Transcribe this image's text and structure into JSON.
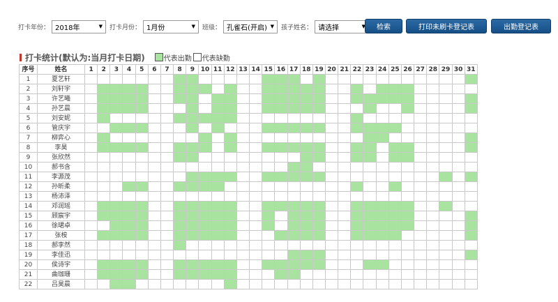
{
  "filters": {
    "year_label": "打卡年份：",
    "year_value": "2018年",
    "month_label": "打卡月份：",
    "month_value": "1月份",
    "class_label": "班级：",
    "class_value": "孔雀石(开启)",
    "child_label": "孩子姓名：",
    "child_value": "请选择"
  },
  "buttons": {
    "search": "检索",
    "print_unpunched": "打印未刷卡登记表",
    "attendance_register": "出勤登记表"
  },
  "stats": {
    "title": "打卡统计(默认为:当月打卡日期)",
    "legend_present": "代表出勤",
    "legend_absent": "代表缺勤"
  },
  "colors": {
    "present": "#a8e4a0",
    "button": "#1e5c96"
  },
  "table": {
    "header_index": "序号",
    "header_name": "姓名",
    "days": [
      1,
      2,
      3,
      4,
      5,
      6,
      7,
      8,
      9,
      10,
      11,
      12,
      13,
      14,
      15,
      16,
      17,
      18,
      19,
      20,
      21,
      22,
      23,
      24,
      25,
      26,
      27,
      28,
      29,
      30,
      31
    ],
    "rows": [
      {
        "index": "1",
        "name": "夏艺轩",
        "present": [
          8,
          9,
          15,
          16,
          17,
          19,
          31
        ]
      },
      {
        "index": "2",
        "name": "刘轩宇",
        "present": [
          2,
          3,
          4,
          5,
          8,
          9,
          10,
          12,
          15,
          16,
          17,
          18,
          19,
          22,
          24,
          25,
          26
        ]
      },
      {
        "index": "3",
        "name": "许艺曦",
        "present": [
          2,
          3,
          4,
          5,
          8,
          9,
          11,
          12,
          15,
          16,
          17,
          18,
          19,
          22,
          23,
          24,
          25,
          26,
          31
        ]
      },
      {
        "index": "4",
        "name": "孙艺晨",
        "present": [
          2,
          3,
          4,
          5,
          9,
          11,
          12,
          15,
          16,
          17,
          18,
          19,
          23,
          26,
          31
        ]
      },
      {
        "index": "5",
        "name": "刘安妮",
        "present": [
          2,
          8,
          9,
          10,
          11,
          12,
          22
        ]
      },
      {
        "index": "6",
        "name": "管庆宇",
        "present": [
          3,
          4,
          5,
          9,
          11,
          15,
          16,
          17,
          18,
          19,
          22,
          23,
          24,
          25
        ]
      },
      {
        "index": "7",
        "name": "柳弈心",
        "present": [
          2,
          10,
          12,
          23,
          24,
          31
        ]
      },
      {
        "index": "8",
        "name": "李昊",
        "present": [
          2,
          3,
          4,
          5,
          8,
          9,
          10,
          12,
          15,
          16,
          17,
          18,
          19,
          22,
          23,
          25,
          26,
          31
        ]
      },
      {
        "index": "9",
        "name": "张欣然",
        "present": [
          8,
          9,
          18,
          19,
          22,
          23,
          25,
          26
        ]
      },
      {
        "index": "10",
        "name": "郝书含",
        "present": [
          17,
          18
        ]
      },
      {
        "index": "11",
        "name": "李源茂",
        "present": [
          9,
          10,
          11,
          12,
          15,
          16,
          17,
          18,
          19,
          29,
          31
        ]
      },
      {
        "index": "12",
        "name": "孙昕柔",
        "present": [
          4,
          5,
          8,
          9,
          10,
          11,
          22,
          25
        ]
      },
      {
        "index": "13",
        "name": "杨沛泽",
        "present": []
      },
      {
        "index": "14",
        "name": "邓润瑶",
        "present": [
          2,
          3,
          4,
          5,
          8,
          9,
          10,
          11,
          12,
          15,
          16,
          17,
          18,
          19,
          22,
          23,
          24,
          25,
          26,
          29
        ]
      },
      {
        "index": "15",
        "name": "顾宸宇",
        "present": [
          2,
          3,
          4,
          5,
          8,
          9,
          10,
          11,
          12,
          15,
          17,
          18,
          19,
          22,
          23,
          24,
          25,
          26,
          31
        ]
      },
      {
        "index": "16",
        "name": "徐珺卓",
        "present": [
          3,
          4,
          5,
          8,
          9,
          10,
          11,
          12,
          15,
          17,
          18,
          19,
          22,
          23,
          24,
          25,
          26,
          31
        ]
      },
      {
        "index": "17",
        "name": "张桉",
        "present": [
          2,
          3,
          4,
          5,
          8,
          9,
          10,
          11,
          12,
          16,
          17,
          18,
          19,
          22,
          23,
          24,
          25,
          31
        ]
      },
      {
        "index": "18",
        "name": "郝李然",
        "present": [
          8
        ]
      },
      {
        "index": "19",
        "name": "李佳迅",
        "present": [
          17,
          18,
          19,
          31
        ]
      },
      {
        "index": "20",
        "name": "侯诗宇",
        "present": [
          2,
          3,
          4,
          5,
          8,
          9,
          10,
          11,
          12,
          15,
          16,
          17,
          18,
          19,
          23,
          24
        ]
      },
      {
        "index": "21",
        "name": "曲珈珊",
        "present": [
          2,
          3,
          4,
          5,
          8,
          9,
          10,
          11,
          12,
          16,
          17
        ]
      },
      {
        "index": "22",
        "name": "吕昊晨",
        "present": [
          3,
          4,
          12
        ]
      }
    ]
  }
}
